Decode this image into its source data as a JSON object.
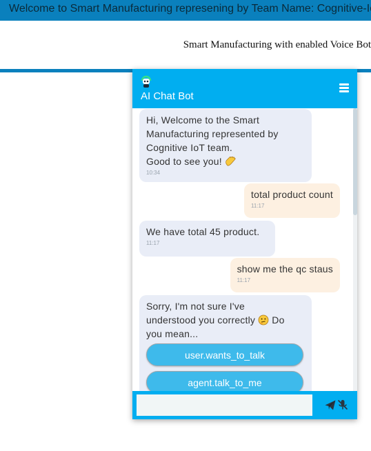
{
  "banner": {
    "marquee_text": "Welcome to Smart Manufacturing represening by Team Name: Cognitive-IoT"
  },
  "page": {
    "subtitle": "Smart Manufacturing with enabled Voice Bot"
  },
  "chat": {
    "title": "AI Chat Bot",
    "input_placeholder": "",
    "messages": [
      {
        "sender": "bot",
        "text": "Hi, Welcome to the Smart\nManufacturing represented by\nCognitive IoT team.\nGood to see you!",
        "time": "10:34",
        "emoji": "waving-hand"
      },
      {
        "sender": "user",
        "text": "total product count",
        "time": "11:17"
      },
      {
        "sender": "bot",
        "text": "We have total 45 product.",
        "time": "11:17"
      },
      {
        "sender": "user",
        "text": "show me the qc staus",
        "time": "11:17"
      },
      {
        "sender": "bot",
        "text_before": "Sorry, I'm not sure I've\nunderstood you correctly",
        "text_after": "Do\nyou mean...",
        "emoji": "thinking-face",
        "choices": [
          "user.wants_to_talk",
          "agent.talk_to_me"
        ]
      }
    ]
  },
  "colors": {
    "header": "#01aef0",
    "banner": "#0a80bd",
    "bot_bubble": "#e9edf7",
    "user_bubble": "#fdf0e1",
    "choice_button": "#3ebaeb"
  },
  "icons": {
    "header_logo": "robot-icon",
    "menu": "hamburger-menu-icon",
    "send": "send-icon",
    "mic": "mic-off-icon"
  }
}
